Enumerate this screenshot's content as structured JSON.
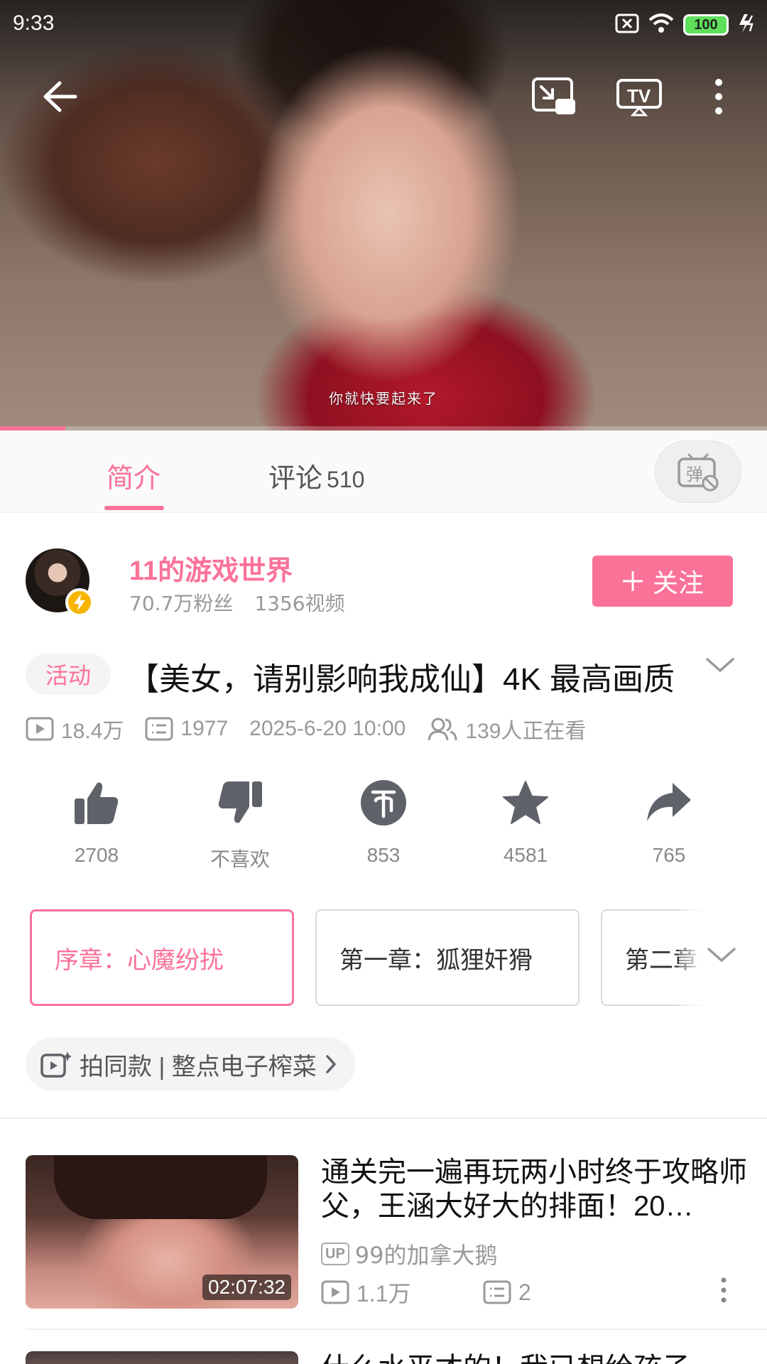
{
  "status_bar": {
    "time": "9:33",
    "battery": "100"
  },
  "video": {
    "subtitle": "你就快要起来了",
    "progress_fraction": 0.085
  },
  "top_controls": {
    "back": "back-arrow-icon",
    "pip": "picture-in-picture-icon",
    "cast": "tv-cast-icon",
    "more": "more-vertical-icon"
  },
  "tabs": {
    "intro": "简介",
    "comments_label": "评论",
    "comments_count": "510",
    "danmaku": "弹"
  },
  "uploader": {
    "name": "11的游戏世界",
    "fans": "70.7万粉丝",
    "videos": "1356视频",
    "follow_label": "关注"
  },
  "video_info": {
    "tag": "活动",
    "title": "【美女，请别影响我成仙】4K 最高画质",
    "views": "18.4万",
    "danmaku_count": "1977",
    "date": "2025-6-20 10:00",
    "watching": "139人正在看"
  },
  "actions": {
    "like": "2708",
    "dislike": "不喜欢",
    "coin": "853",
    "favorite": "4581",
    "share": "765"
  },
  "episodes": [
    "序章：心魔纷扰",
    "第一章：狐狸奸猾",
    "第二章"
  ],
  "same_style": {
    "label": "拍同款 | 整点电子榨菜"
  },
  "recommendations": [
    {
      "title": "通关完一遍再玩两小时终于攻略师父，王涵大好大的排面！20…",
      "duration": "02:07:32",
      "up_badge": "UP",
      "author": "99的加拿大鹅",
      "views": "1.1万",
      "danmaku": "2"
    },
    {
      "title": "什么水平才的！我已想给孩子"
    }
  ],
  "colors": {
    "accent": "#fb7299",
    "muted": "#999999",
    "icon": "#5f6268"
  }
}
